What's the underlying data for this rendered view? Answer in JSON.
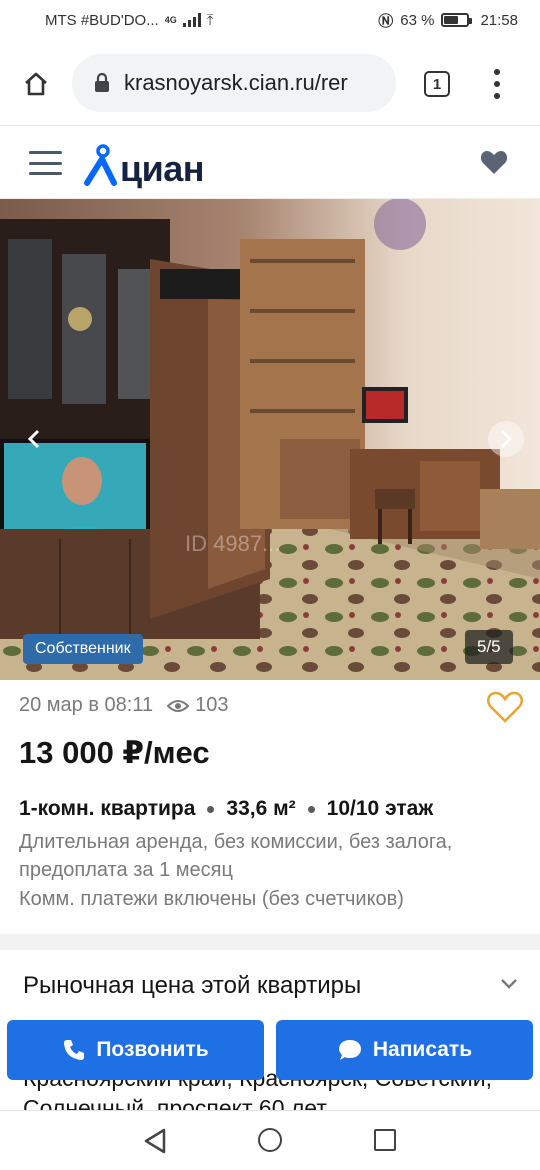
{
  "status_bar": {
    "carrier": "MTS #BUD'DO...",
    "network": "4G",
    "battery": "63 %",
    "battery_level": 0.63,
    "time": "21:58"
  },
  "browser": {
    "url": "krasnoyarsk.cian.ru/rer",
    "tab_count": "1"
  },
  "site": {
    "logo_text": "циан"
  },
  "gallery": {
    "owner_badge": "Собственник",
    "counter": "5/5",
    "watermark": "ID 4987..."
  },
  "listing": {
    "date": "20 мар в 08:11",
    "views": "103",
    "price": "13 000 ₽/мес",
    "rooms": "1-комн. квартира",
    "area": "33,6 м²",
    "floor": "10/10 этаж",
    "terms": "Длительная аренда, без комиссии, без залога, предоплата за 1 месяц",
    "utilities": "Комм. платежи включены (без счетчиков)"
  },
  "market": {
    "title": "Рыночная цена этой квартиры"
  },
  "address": {
    "text": "Красноярский край, Красноярск, Советский, Солнечный, проспект 60 лет"
  },
  "actions": {
    "call_label": "Позвонить",
    "write_label": "Написать"
  },
  "colors": {
    "accent": "#1f6fe5",
    "owner_badge": "#2f6ba8",
    "favorite": "#e8a533",
    "logo_dark": "#152242",
    "logo_blue": "#0468ff"
  },
  "icons": [
    "home-icon",
    "lock-icon",
    "tabs-icon",
    "more-icon",
    "menu-icon",
    "heart-icon",
    "chevron-left-icon",
    "chevron-right-icon",
    "eye-icon",
    "chevron-down-icon",
    "phone-icon",
    "chat-icon"
  ]
}
